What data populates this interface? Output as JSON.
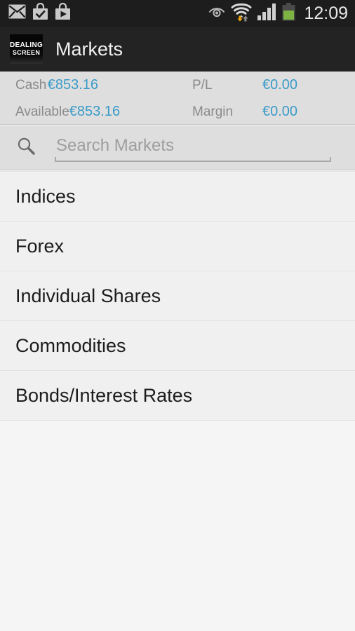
{
  "statusbar": {
    "time": "12:09",
    "left_icons": [
      {
        "name": "email-icon",
        "label": "Email"
      },
      {
        "name": "play-store-update-icon",
        "label": "App update"
      },
      {
        "name": "play-store-icon",
        "label": "Play Store"
      }
    ],
    "right_icons": [
      {
        "name": "eye-icon",
        "label": "Smart stay"
      },
      {
        "name": "wifi-transfer-icon",
        "label": "Wi-Fi active"
      },
      {
        "name": "cellular-signal-icon",
        "label": "Signal"
      },
      {
        "name": "battery-icon",
        "label": "Battery"
      }
    ],
    "colors": {
      "background": "#1d1d1d",
      "text": "#e8e8e8",
      "battery_fill": "#7cb342",
      "wifi_down_arrow": "#f0a30a"
    }
  },
  "actionbar": {
    "logo_line1": "DEALING",
    "logo_line2": "SCREEN",
    "title": "Markets",
    "colors": {
      "background": "#232323",
      "text": "#f2f2f2"
    }
  },
  "account": {
    "cash_label": "Cash",
    "cash_value": "€853.16",
    "pl_label": "P/L",
    "pl_value": "€0.00",
    "available_label": "Available",
    "available_value": "€853.16",
    "margin_label": "Margin",
    "margin_value": "€0.00",
    "colors": {
      "background": "#dedede",
      "label": "#8a8a8a",
      "value": "#3a9bc8"
    }
  },
  "search": {
    "placeholder": "Search Markets",
    "value": "",
    "icon": "search-icon"
  },
  "markets": {
    "items": [
      {
        "label": "Indices"
      },
      {
        "label": "Forex"
      },
      {
        "label": "Individual Shares"
      },
      {
        "label": "Commodities"
      },
      {
        "label": "Bonds/Interest Rates"
      }
    ]
  }
}
